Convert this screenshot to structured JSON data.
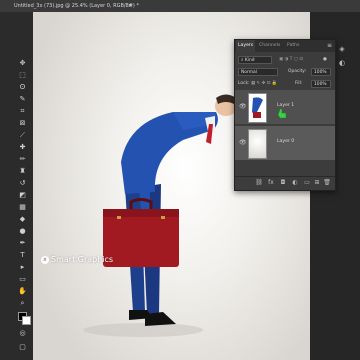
{
  "window": {
    "title_tab": "Untitled_3x (73).jpg @ 25.4% (Layer 0, RGB/8#) *",
    "close_symbol": "×"
  },
  "toolbar": {
    "tools": [
      "move-icon",
      "marquee-icon",
      "lasso-icon",
      "quick-select-icon",
      "crop-icon",
      "frame-icon",
      "eyedropper-icon",
      "healing-icon",
      "brush-icon",
      "stamp-icon",
      "history-brush-icon",
      "eraser-icon",
      "gradient-icon",
      "blur-icon",
      "dodge-icon",
      "pen-icon",
      "type-icon",
      "path-select-icon",
      "shape-icon",
      "hand-icon",
      "zoom-icon",
      "more-icon"
    ],
    "foreground_color": "#000000",
    "background_color": "#ffffff"
  },
  "layers_panel": {
    "tabs": [
      "Layers",
      "Channels",
      "Paths"
    ],
    "active_tab": "Layers",
    "filter_label": "Kind",
    "blend_mode": "Normal",
    "opacity_label": "Opacity:",
    "opacity_value": "100%",
    "lock_label": "Lock:",
    "fill_label": "Fill:",
    "fill_value": "100%",
    "layers": [
      {
        "name": "Layer 1",
        "visible": true,
        "selected": true
      },
      {
        "name": "Layer 0",
        "visible": true,
        "selected": false
      }
    ]
  },
  "tooltip": {
    "label": "Smart Graphics"
  },
  "colors": {
    "accent_green": "#3ecf4a",
    "panel_bg": "#3c3c3c",
    "app_bg": "#2b2b2b"
  }
}
